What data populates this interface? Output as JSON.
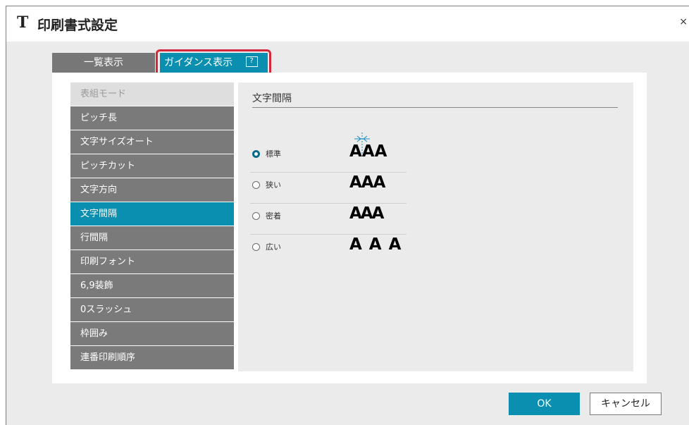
{
  "window": {
    "icon_glyph": "T",
    "title": "印刷書式設定",
    "close_glyph": "×"
  },
  "tabs": [
    {
      "label": "一覧表示",
      "active": false
    },
    {
      "label": "ガイダンス表示",
      "active": true,
      "help_glyph": "?"
    }
  ],
  "sidebar": {
    "items": [
      {
        "label": "表組モード",
        "state": "disabled"
      },
      {
        "label": "ピッチ長",
        "state": "normal"
      },
      {
        "label": "文字サイズオート",
        "state": "normal"
      },
      {
        "label": "ピッチカット",
        "state": "normal"
      },
      {
        "label": "文字方向",
        "state": "normal"
      },
      {
        "label": "文字間隔",
        "state": "active"
      },
      {
        "label": "行間隔",
        "state": "normal"
      },
      {
        "label": "印刷フォント",
        "state": "normal"
      },
      {
        "label": "6,9装飾",
        "state": "normal"
      },
      {
        "label": "0スラッシュ",
        "state": "normal"
      },
      {
        "label": "枠囲み",
        "state": "normal"
      },
      {
        "label": "連番印刷順序",
        "state": "normal"
      }
    ]
  },
  "panel": {
    "title": "文字間隔",
    "options": [
      {
        "label": "標準",
        "sample": "AAA",
        "checked": true
      },
      {
        "label": "狭い",
        "sample": "AAA",
        "checked": false
      },
      {
        "label": "密着",
        "sample": "AAA",
        "checked": false
      },
      {
        "label": "広い",
        "sample": "A A A",
        "checked": false
      }
    ]
  },
  "buttons": {
    "ok": "OK",
    "cancel": "キャンセル"
  },
  "colors": {
    "accent": "#0a8fb0",
    "highlight": "#d1283c",
    "sidebar_bg": "#7a7a7a"
  }
}
